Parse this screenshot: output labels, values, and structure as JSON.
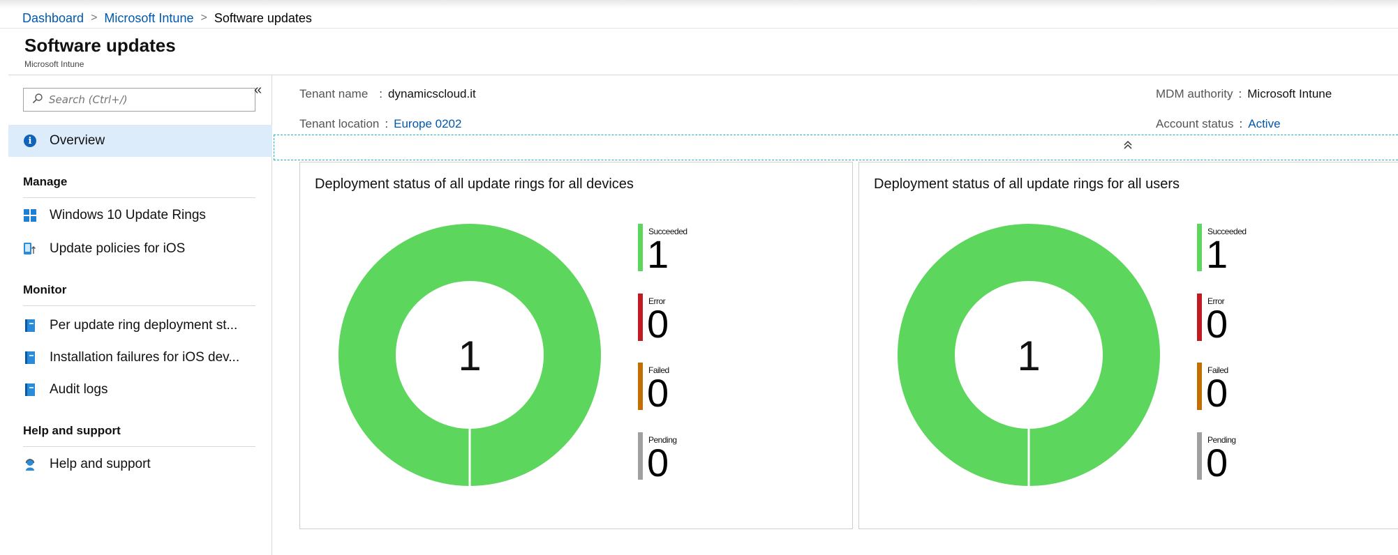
{
  "breadcrumb": {
    "items": [
      "Dashboard",
      "Microsoft Intune"
    ],
    "current": "Software updates"
  },
  "page": {
    "title": "Software updates",
    "subtitle": "Microsoft Intune"
  },
  "sidebar": {
    "search_placeholder": "Search (Ctrl+/)",
    "collapse_glyph": "«",
    "overview": "Overview",
    "sections": {
      "manage": "Manage",
      "monitor": "Monitor",
      "help": "Help and support"
    },
    "manage_items": [
      "Windows 10 Update Rings",
      "Update policies for iOS"
    ],
    "monitor_items": [
      "Per update ring deployment st...",
      "Installation failures for iOS dev...",
      "Audit logs"
    ],
    "help_items": [
      "Help and support"
    ]
  },
  "essentials": {
    "tenant_name_label": "Tenant name",
    "tenant_name": "dynamicscloud.it",
    "tenant_location_label": "Tenant location",
    "tenant_location": "Europe 0202",
    "mdm_authority_label": "MDM authority",
    "mdm_authority": "Microsoft Intune",
    "account_status_label": "Account status",
    "account_status": "Active",
    "colon": ":",
    "collapse_glyph": "˄"
  },
  "colors": {
    "succeeded": "#5cd65c",
    "error": "#c01a23",
    "failed": "#c26f00",
    "pending": "#a0a0a0",
    "link": "#0058ad"
  },
  "tiles": [
    {
      "title": "Deployment status of all update rings for all devices",
      "center_value": "1",
      "legend": [
        {
          "label": "Succeeded",
          "count": "1"
        },
        {
          "label": "Error",
          "count": "0"
        },
        {
          "label": "Failed",
          "count": "0"
        },
        {
          "label": "Pending",
          "count": "0"
        }
      ]
    },
    {
      "title": "Deployment status of all update rings for all users",
      "center_value": "1",
      "legend": [
        {
          "label": "Succeeded",
          "count": "1"
        },
        {
          "label": "Error",
          "count": "0"
        },
        {
          "label": "Failed",
          "count": "0"
        },
        {
          "label": "Pending",
          "count": "0"
        }
      ]
    }
  ],
  "chart_data": [
    {
      "type": "pie",
      "title": "Deployment status of all update rings for all devices",
      "categories": [
        "Succeeded",
        "Error",
        "Failed",
        "Pending"
      ],
      "values": [
        1,
        0,
        0,
        0
      ]
    },
    {
      "type": "pie",
      "title": "Deployment status of all update rings for all users",
      "categories": [
        "Succeeded",
        "Error",
        "Failed",
        "Pending"
      ],
      "values": [
        1,
        0,
        0,
        0
      ]
    }
  ]
}
